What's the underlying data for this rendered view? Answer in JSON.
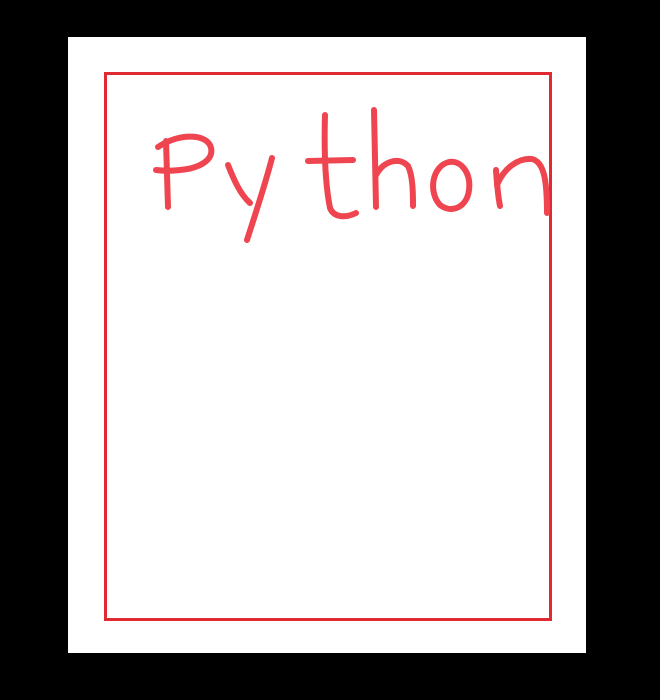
{
  "canvas": {
    "background_color": "#000000",
    "page_color": "#ffffff",
    "frame_color": "#e02a33",
    "ink_color": "#ef4550"
  },
  "handwritten_text": "Python"
}
